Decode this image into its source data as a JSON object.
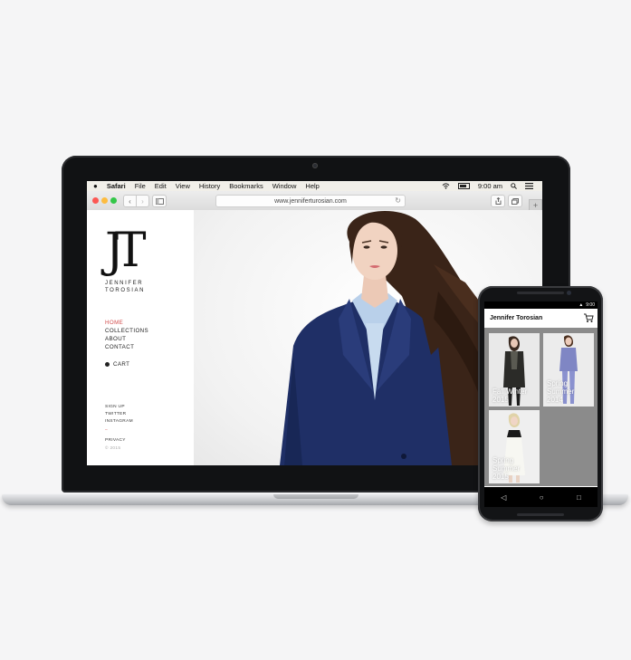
{
  "menubar": {
    "apple_icon": "apple-logo-icon",
    "items": [
      "Safari",
      "File",
      "Edit",
      "View",
      "History",
      "Bookmarks",
      "Window",
      "Help"
    ],
    "clock": "9:00 am",
    "right_icons": [
      "wifi-icon",
      "battery-icon",
      "spotlight-icon",
      "notification-list-icon"
    ]
  },
  "browser": {
    "url": "www.jenniferturosian.com",
    "back_glyph": "‹",
    "forward_glyph": "›",
    "newtab_glyph": "+"
  },
  "site": {
    "logo_mark": "JT",
    "logo_text_1": "JENNIFER",
    "logo_text_2": "TOROSIAN",
    "nav": {
      "home": "HOME",
      "collections": "COLLECTIONS",
      "about": "ABOUT",
      "contact": "CONTACT",
      "cart": "CART"
    },
    "footer": {
      "signup": "SIGN UP",
      "twitter": "TWITTER",
      "instagram": "INSTAGRAM",
      "dash": "–",
      "privacy": "PRIVACY",
      "copyright": "© 2015"
    },
    "accent_color": "#d24b4b"
  },
  "phone": {
    "status_time": "9:00",
    "app_title": "Jennifer Torosian",
    "tiles": [
      {
        "line1": "Fall Winter",
        "line2": "2015"
      },
      {
        "line1": "Spring",
        "line2": "Summer",
        "line3": "2014"
      },
      {
        "line1": "Spring",
        "line2": "Summer",
        "line3": "2015"
      }
    ],
    "nav_back": "◁",
    "nav_home": "○",
    "nav_recent": "□"
  }
}
